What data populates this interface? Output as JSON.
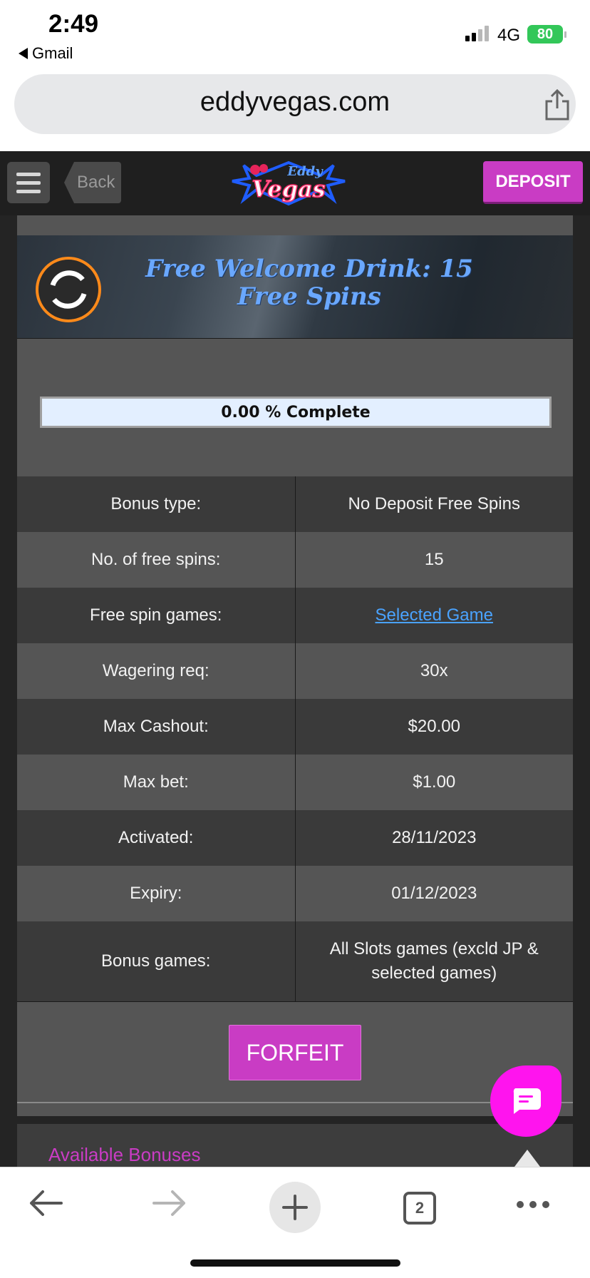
{
  "status_bar": {
    "time": "2:49",
    "back_app": "Gmail",
    "network": "4G",
    "battery": "80"
  },
  "browser": {
    "url": "eddyvegas.com",
    "tab_count": "2"
  },
  "header": {
    "back_label": "Back",
    "deposit_label": "DEPOSIT",
    "logo_text": "Eddy Vegas"
  },
  "bonus": {
    "title": "Free Welcome Drink: 15 Free Spins",
    "progress_text": "0.00 % Complete",
    "progress_value": 0.0,
    "rows": [
      {
        "label": "Bonus type:",
        "value": "No Deposit Free Spins"
      },
      {
        "label": "No. of free spins:",
        "value": "15"
      },
      {
        "label": "Free spin games:",
        "value": "Selected Game"
      },
      {
        "label": "Wagering req:",
        "value": "30x"
      },
      {
        "label": "Max Cashout:",
        "value": "$20.00"
      },
      {
        "label": "Max bet:",
        "value": "$1.00"
      },
      {
        "label": "Activated:",
        "value": "28/11/2023"
      },
      {
        "label": "Expiry:",
        "value": "01/12/2023"
      },
      {
        "label": "Bonus games:",
        "value": "All Slots games (excld JP & selected games)"
      }
    ],
    "forfeit_label": "FORFEIT"
  },
  "available": {
    "label": "Available Bonuses"
  },
  "colors": {
    "accent": "#c93cc4",
    "chat": "#ff14ee",
    "title": "#6aa8ff",
    "link": "#4aa3ff"
  }
}
